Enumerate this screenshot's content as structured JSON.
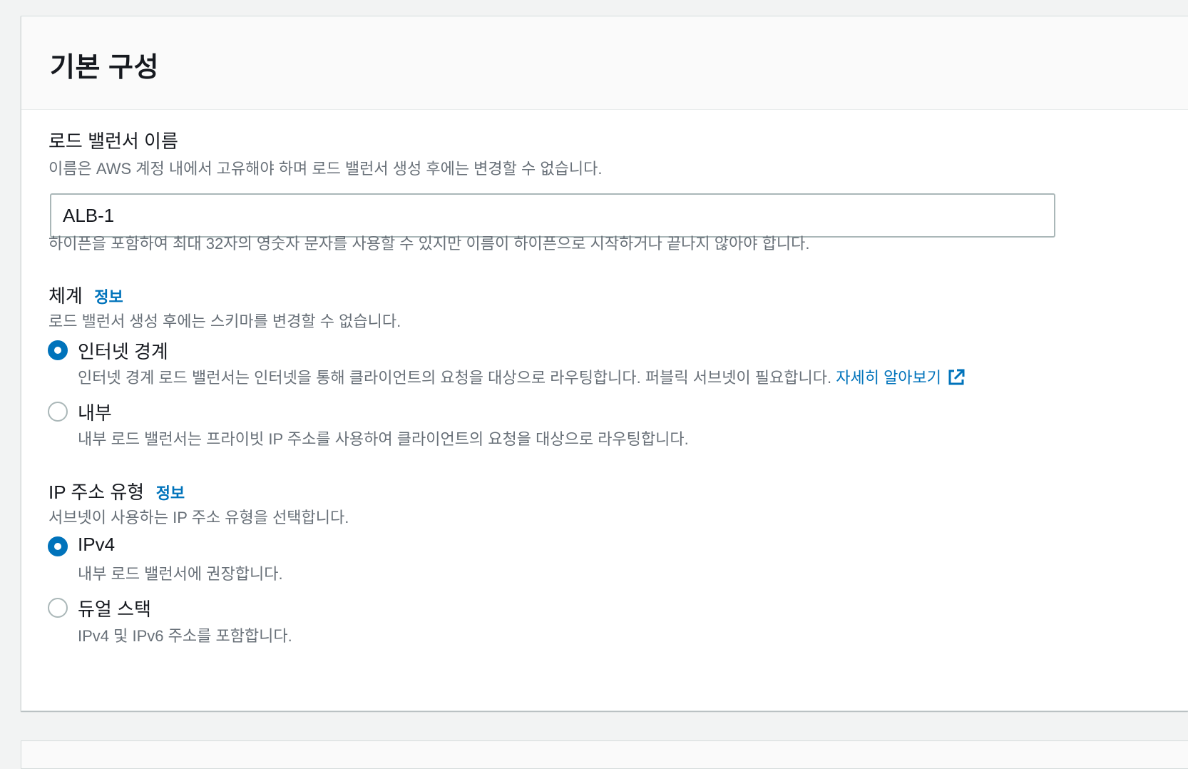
{
  "section": {
    "title": "기본 구성"
  },
  "lb_name": {
    "label": "로드 밸런서 이름",
    "description": "이름은 AWS 계정 내에서 고유해야 하며 로드 밸런서 생성 후에는 변경할 수 없습니다.",
    "value": "ALB-1",
    "constraint": "하이픈을 포함하여 최대 32자의 영숫자 문자를 사용할 수 있지만 이름이 하이픈으로 시작하거나 끝나지 않아야 합니다."
  },
  "scheme": {
    "label": "체계",
    "info": "정보",
    "description": "로드 밸런서 생성 후에는 스키마를 변경할 수 없습니다.",
    "options": [
      {
        "label": "인터넷 경계",
        "description": "인터넷 경계 로드 밸런서는 인터넷을 통해 클라이언트의 요청을 대상으로 라우팅합니다. 퍼블릭 서브넷이 필요합니다.",
        "link": "자세히 알아보기",
        "selected": true
      },
      {
        "label": "내부",
        "description": "내부 로드 밸런서는 프라이빗 IP 주소를 사용하여 클라이언트의 요청을 대상으로 라우팅합니다.",
        "selected": false
      }
    ]
  },
  "ip_type": {
    "label": "IP 주소 유형",
    "info": "정보",
    "description": "서브넷이 사용하는 IP 주소 유형을 선택합니다.",
    "options": [
      {
        "label": "IPv4",
        "description": "내부 로드 밸런서에 권장합니다.",
        "selected": true
      },
      {
        "label": "듀얼 스택",
        "description": "IPv4 및 IPv6 주소를 포함합니다.",
        "selected": false
      }
    ]
  },
  "icons": {
    "external_link": "external-link-icon"
  },
  "colors": {
    "accent": "#0073bb",
    "text": "#16191f",
    "muted": "#687078",
    "background": "#f2f3f3"
  }
}
